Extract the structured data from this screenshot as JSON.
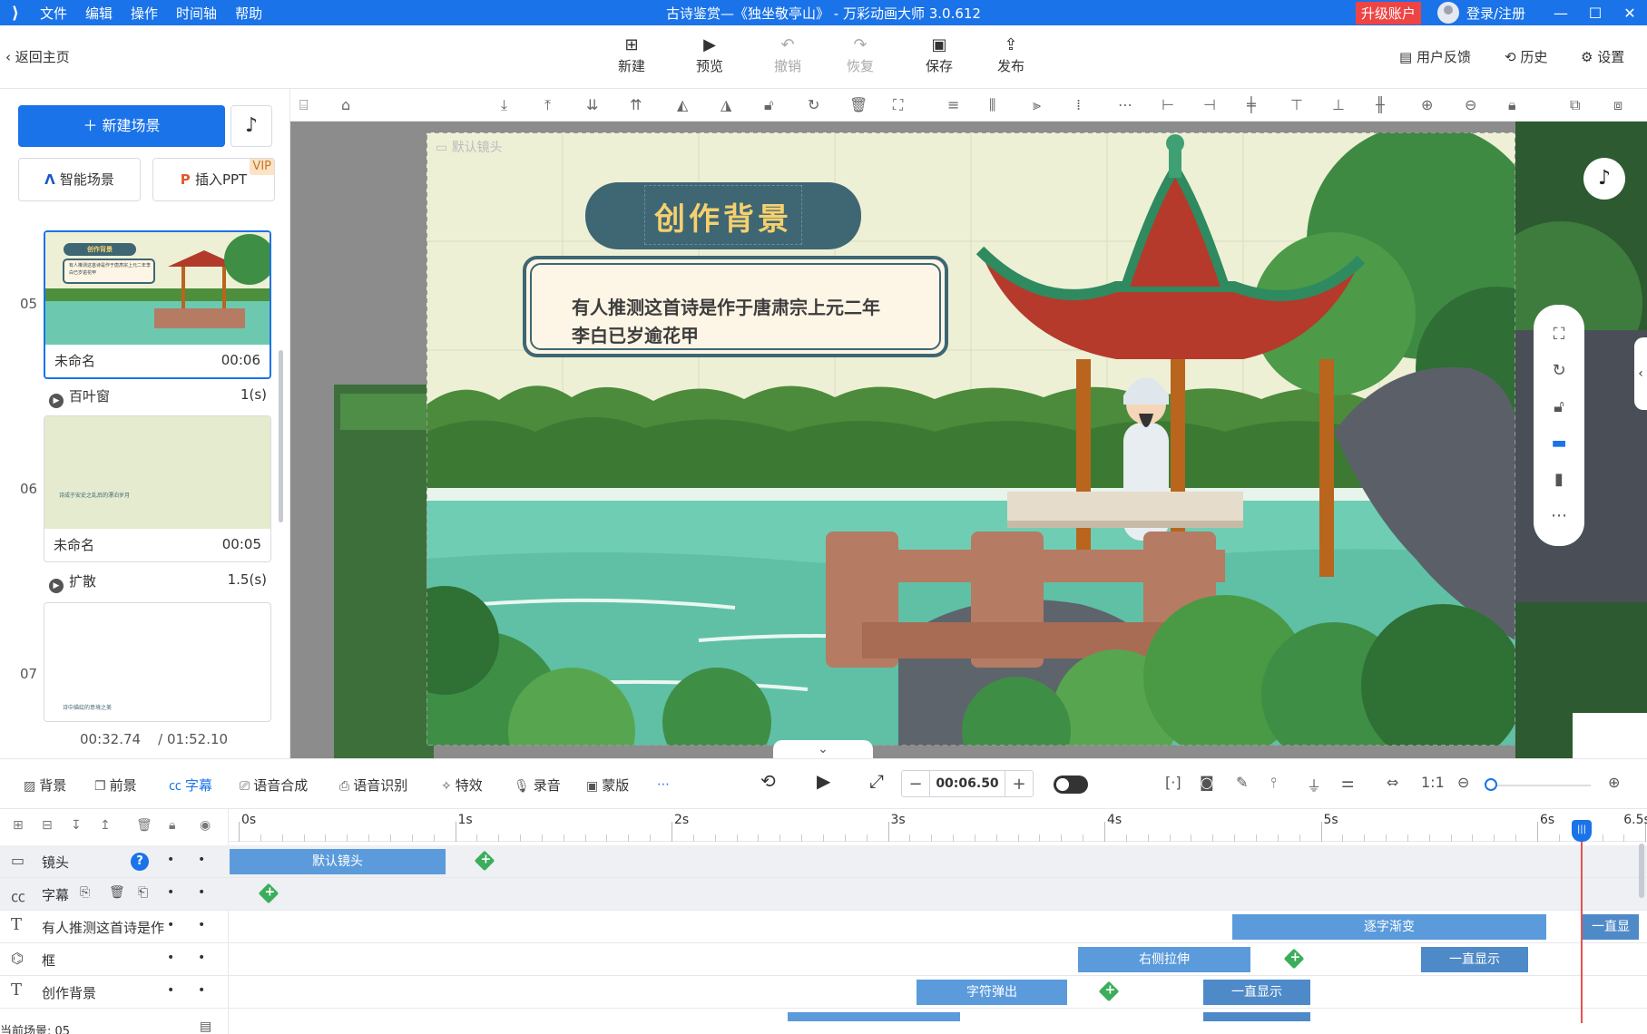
{
  "app": {
    "title": "古诗鉴赏—《独坐敬亭山》 - 万彩动画大师 3.0.612",
    "menu": [
      "文件",
      "编辑",
      "操作",
      "时间轴",
      "帮助"
    ],
    "upgrade": "升级账户",
    "login": "登录/注册"
  },
  "toolbar": {
    "back": "返回主页",
    "new": "新建",
    "preview": "预览",
    "undo": "撤销",
    "redo": "恢复",
    "save": "保存",
    "publish": "发布",
    "feedback": "用户反馈",
    "history": "历史",
    "settings": "设置"
  },
  "left": {
    "new_scene": "新建场景",
    "smart_scene": "智能场景",
    "insert_ppt": "插入PPT",
    "vip": "VIP",
    "scenes": [
      {
        "num": "05",
        "name": "未命名",
        "time": "00:06",
        "transition": "百叶窗",
        "trans_time": "1(s)"
      },
      {
        "num": "06",
        "name": "未命名",
        "time": "00:05",
        "transition": "扩散",
        "trans_time": "1.5(s)"
      },
      {
        "num": "07"
      }
    ],
    "current_time": "00:32.74",
    "total_time": "/ 01:52.10"
  },
  "canvas": {
    "camera_label": "默认镜头",
    "title": "创作背景",
    "text_line1": "有人推测这首诗是作于唐肃宗上元二年",
    "text_line2": "李白已岁逾花甲",
    "thumb_title": "创作背景",
    "thumb_text": "有人推测这首诗是作于唐肃宗上元二年李白已岁逾花甲",
    "thumb6_text": "诗成于安史之乱后的漂泊岁月",
    "thumb7_text": "诗中描绘的意境之美"
  },
  "bottombar": {
    "tabs": [
      "背景",
      "前景",
      "字幕",
      "语音合成",
      "语音识别",
      "特效",
      "录音",
      "蒙版"
    ],
    "active_tab": "字幕",
    "time_value": "00:06.50"
  },
  "timeline": {
    "ticks": [
      "0s",
      "1s",
      "2s",
      "3s",
      "4s",
      "5s",
      "6s",
      "6.5s"
    ],
    "rows": [
      {
        "name": "镜头",
        "clips": [
          {
            "label": "默认镜头"
          }
        ]
      },
      {
        "name": "字幕",
        "clips": []
      },
      {
        "name": "有人推测这首诗是作",
        "clips": [
          {
            "label": "逐字渐变"
          },
          {
            "label": "一直显"
          }
        ]
      },
      {
        "name": "框",
        "clips": [
          {
            "label": "右侧拉伸"
          },
          {
            "label": "一直显示"
          }
        ]
      },
      {
        "name": "创作背景",
        "clips": [
          {
            "label": "字符弹出"
          },
          {
            "label": "一直显示"
          }
        ]
      }
    ],
    "current_scene": "当前场景: 05"
  }
}
